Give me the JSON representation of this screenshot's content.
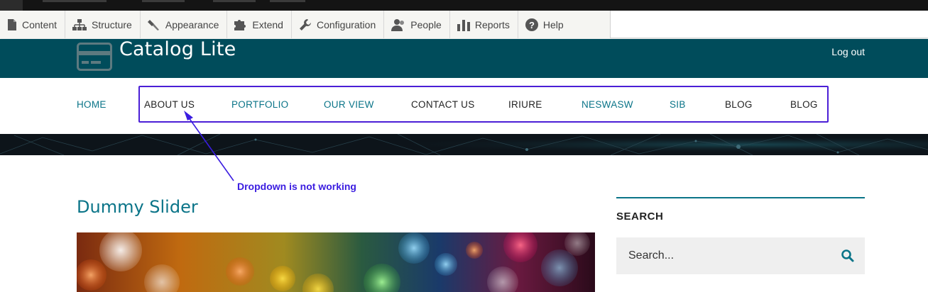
{
  "toolbar": {
    "items": [
      {
        "label": "Content",
        "icon": "file-icon"
      },
      {
        "label": "Structure",
        "icon": "sitemap-icon"
      },
      {
        "label": "Appearance",
        "icon": "paint-icon"
      },
      {
        "label": "Extend",
        "icon": "puzzle-icon"
      },
      {
        "label": "Configuration",
        "icon": "wrench-icon"
      },
      {
        "label": "People",
        "icon": "people-icon"
      },
      {
        "label": "Reports",
        "icon": "bar-chart-icon"
      },
      {
        "label": "Help",
        "icon": "help-icon"
      }
    ]
  },
  "header": {
    "site_name": "Catalog Lite",
    "logout": "Log out",
    "bg_color": "#004c5b"
  },
  "nav": {
    "items": [
      {
        "label": "HOME",
        "color": "#0a7488"
      },
      {
        "label": "ABOUT US",
        "color": "#222222"
      },
      {
        "label": "PORTFOLIO",
        "color": "#0a7488"
      },
      {
        "label": "OUR VIEW",
        "color": "#0a7488"
      },
      {
        "label": "CONTACT US",
        "color": "#222222"
      },
      {
        "label": "IRIURE",
        "color": "#222222"
      },
      {
        "label": "NESWASW",
        "color": "#0a7488"
      },
      {
        "label": "SIB",
        "color": "#0a7488"
      },
      {
        "label": "BLOG",
        "color": "#222222"
      },
      {
        "label": "BLOG",
        "color": "#222222"
      }
    ]
  },
  "annotation": {
    "text": "Dropdown is not working",
    "color": "#4b1fd6"
  },
  "content": {
    "title": "Dummy Slider"
  },
  "sidebar": {
    "heading": "SEARCH",
    "search_placeholder": "Search...",
    "accent": "#0a7488"
  }
}
